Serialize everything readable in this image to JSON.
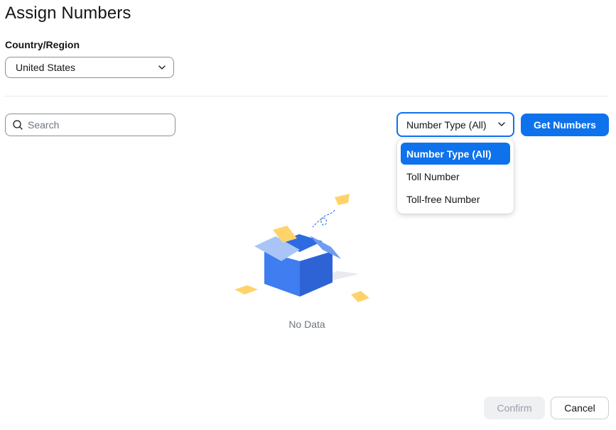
{
  "page": {
    "title": "Assign Numbers"
  },
  "country": {
    "label": "Country/Region",
    "selected": "United States",
    "icon": "chevron-down-icon"
  },
  "search": {
    "placeholder": "Search",
    "value": "",
    "icon": "search-icon"
  },
  "number_type": {
    "selected": "Number Type (All)",
    "icon": "chevron-down-icon",
    "options": [
      {
        "label": "Number Type (All)",
        "selected": true
      },
      {
        "label": "Toll Number",
        "selected": false
      },
      {
        "label": "Toll-free Number",
        "selected": false
      }
    ]
  },
  "actions": {
    "get_numbers": "Get Numbers",
    "confirm": "Confirm",
    "cancel": "Cancel"
  },
  "empty_state": {
    "text": "No Data",
    "icon": "empty-box-icon"
  },
  "colors": {
    "accent": "#0e72ed",
    "box_blue": "#3f7df0",
    "paper_yellow": "#ffd36b"
  }
}
